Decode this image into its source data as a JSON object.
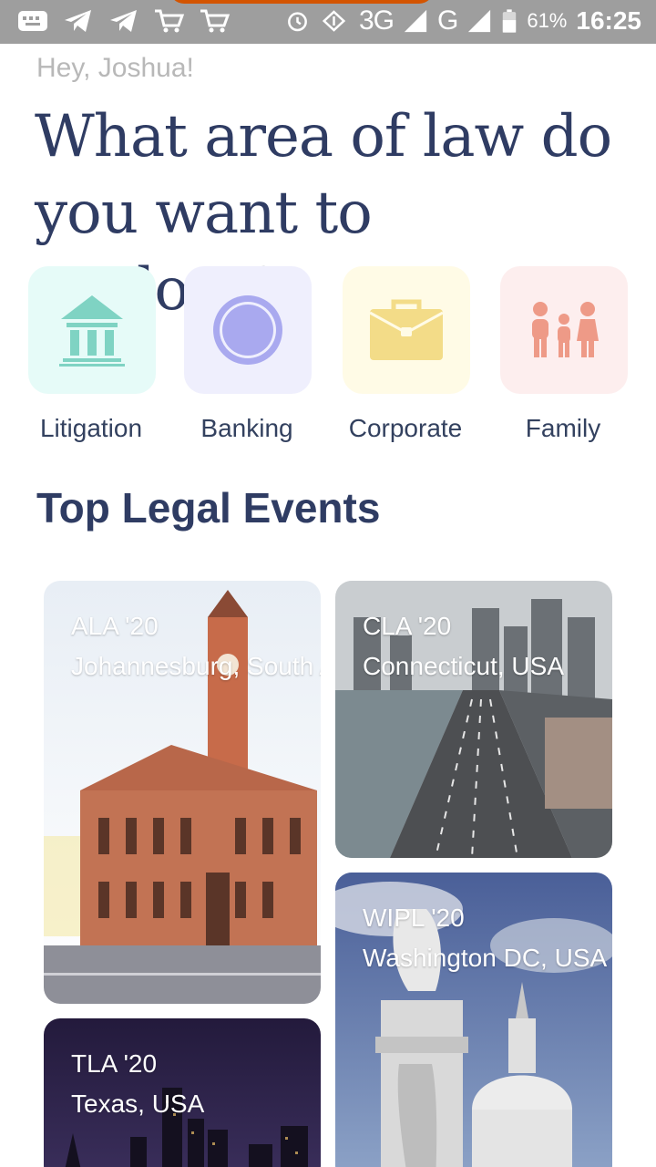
{
  "status": {
    "network_3g": "3G",
    "network_g": "G",
    "battery": "61%",
    "time": "16:25"
  },
  "greeting": "Hey, Joshua!",
  "headline": "What area of law do you want to explore?",
  "categories": [
    {
      "label": "Litigation",
      "icon": "courthouse-icon",
      "bg": "#e6fbf8",
      "color": "#7fd3c3"
    },
    {
      "label": "Banking",
      "icon": "ring-icon",
      "bg": "#efeffd",
      "color": "#a9a9ef"
    },
    {
      "label": "Corporate",
      "icon": "briefcase-icon",
      "bg": "#fffbe6",
      "color": "#f3dc88"
    },
    {
      "label": "Family",
      "icon": "family-icon",
      "bg": "#fdeeee",
      "color": "#ee9a87"
    }
  ],
  "section_title": "Top Legal Events",
  "events": [
    {
      "code": "ALA '20",
      "location": "Johannesburg, South Africa"
    },
    {
      "code": "CLA '20",
      "location": "Connecticut, USA"
    },
    {
      "code": "WIPL '20",
      "location": "Washington DC, USA"
    },
    {
      "code": "TLA '20",
      "location": "Texas, USA"
    }
  ]
}
